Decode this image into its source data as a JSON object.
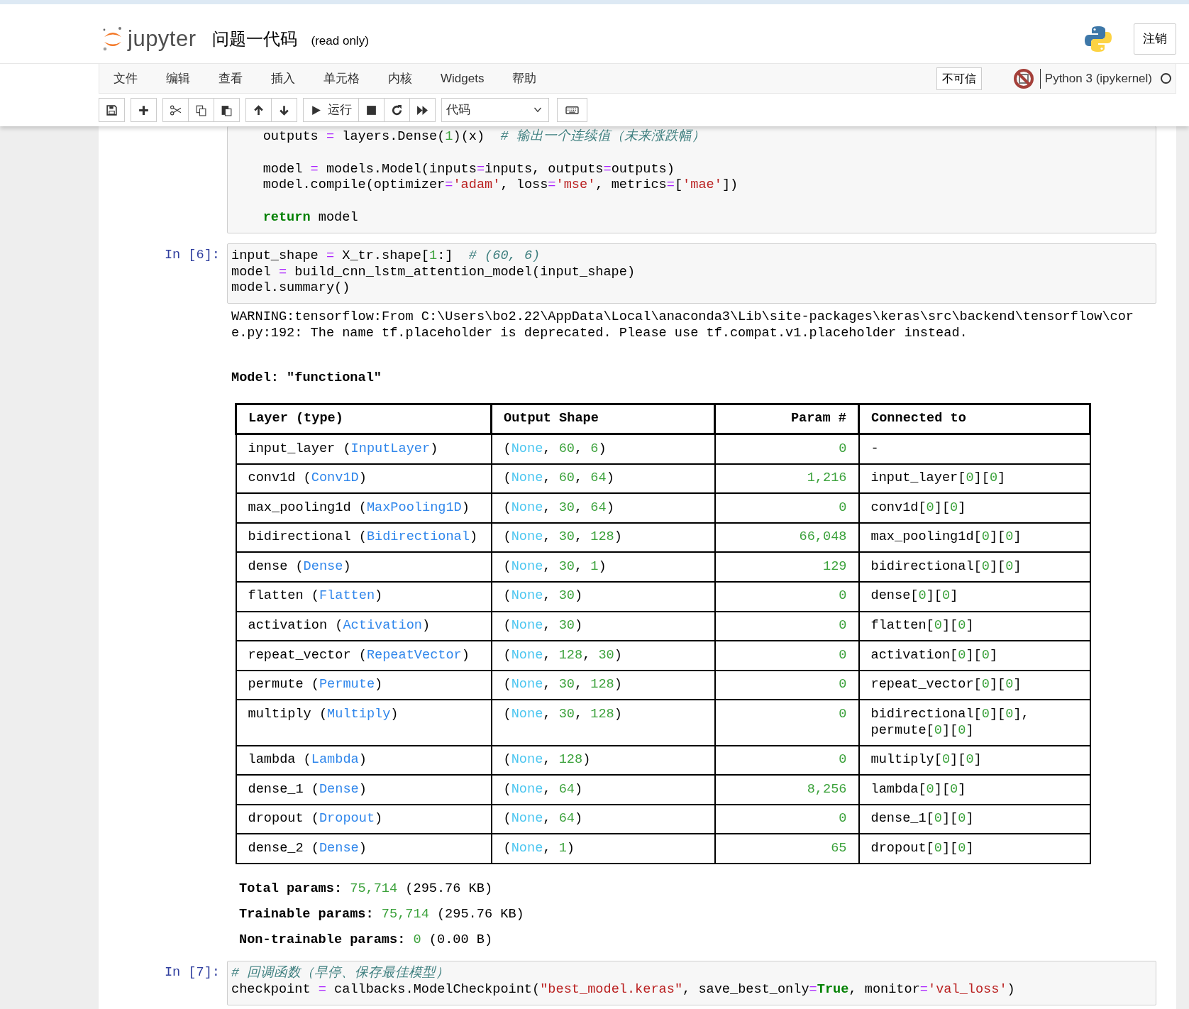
{
  "header": {
    "logo_text": "jupyter",
    "notebook_title": "问题一代码",
    "mode_note": "(read only)",
    "logout_button": "注销"
  },
  "menubar": {
    "menus": [
      "文件",
      "编辑",
      "查看",
      "插入",
      "单元格",
      "内核",
      "Widgets",
      "帮助"
    ],
    "trust_badge": "不可信",
    "kernel_name": "Python 3 (ipykernel)",
    "kernel_idle": true
  },
  "toolbar": {
    "run_label": "运行",
    "cell_type": "代码"
  },
  "cells": [
    {
      "code_blocks": [
        [
          [
            {
              "text": "    outputs ",
              "kind": "plain"
            },
            {
              "text": "=",
              "kind": "op"
            },
            {
              "text": " layers.Dense(",
              "kind": "plain"
            },
            {
              "text": "1",
              "kind": "num"
            },
            {
              "text": ")(x)  ",
              "kind": "plain"
            },
            {
              "text": "# 输出一个连续值（未来涨跌幅）",
              "kind": "cmt"
            }
          ]
        ],
        [
          [
            {
              "text": "    model ",
              "kind": "plain"
            },
            {
              "text": "=",
              "kind": "op"
            },
            {
              "text": " models.Model(inputs",
              "kind": "plain"
            },
            {
              "text": "=",
              "kind": "op"
            },
            {
              "text": "inputs, outputs",
              "kind": "plain"
            },
            {
              "text": "=",
              "kind": "op"
            },
            {
              "text": "outputs)",
              "kind": "plain"
            }
          ],
          [
            {
              "text": "    model.compile(optimizer",
              "kind": "plain"
            },
            {
              "text": "=",
              "kind": "op"
            },
            {
              "text": "'adam'",
              "kind": "str"
            },
            {
              "text": ", loss",
              "kind": "plain"
            },
            {
              "text": "=",
              "kind": "op"
            },
            {
              "text": "'mse'",
              "kind": "str"
            },
            {
              "text": ", metrics",
              "kind": "plain"
            },
            {
              "text": "=",
              "kind": "op"
            },
            {
              "text": "[",
              "kind": "plain"
            },
            {
              "text": "'mae'",
              "kind": "str"
            },
            {
              "text": "])",
              "kind": "plain"
            }
          ]
        ],
        [
          [
            {
              "text": "    return",
              "kind": "kw"
            },
            {
              "text": " model",
              "kind": "plain"
            }
          ]
        ]
      ]
    },
    {
      "prompt": "In [6]:",
      "code_blocks": [
        [
          [
            {
              "text": "input_shape ",
              "kind": "plain"
            },
            {
              "text": "=",
              "kind": "op"
            },
            {
              "text": " X_tr.shape[",
              "kind": "plain"
            },
            {
              "text": "1",
              "kind": "num"
            },
            {
              "text": ":]  ",
              "kind": "plain"
            },
            {
              "text": "# (60, 6)",
              "kind": "cmt"
            }
          ],
          [
            {
              "text": "model ",
              "kind": "plain"
            },
            {
              "text": "=",
              "kind": "op"
            },
            {
              "text": " build_cnn_lstm_attention_model(input_shape)",
              "kind": "plain"
            }
          ],
          [
            {
              "text": "model.summary()",
              "kind": "plain"
            }
          ]
        ]
      ],
      "output": {
        "warning": "WARNING:tensorflow:From C:\\Users\\bo2.22\\AppData\\Local\\anaconda3\\Lib\\site-packages\\keras\\src\\backend\\tensorflow\\core.py:192: The name tf.placeholder is deprecated. Please use tf.compat.v1.placeholder instead.",
        "model_title": "Model: \"functional\"",
        "summary_table": {
          "columns": [
            "Layer (type)",
            "Output Shape",
            "Param #",
            "Connected to"
          ],
          "rows": [
            {
              "layer": [
                {
                  "text": "input_layer (",
                  "kind": "plain"
                },
                {
                  "text": "InputLayer",
                  "kind": "type"
                },
                {
                  "text": ")",
                  "kind": "plain"
                }
              ],
              "output_shape": [
                {
                  "text": "(",
                  "kind": "plain"
                },
                {
                  "text": "None",
                  "kind": "none"
                },
                {
                  "text": ", ",
                  "kind": "plain"
                },
                {
                  "text": "60",
                  "kind": "num"
                },
                {
                  "text": ", ",
                  "kind": "plain"
                },
                {
                  "text": "6",
                  "kind": "num"
                },
                {
                  "text": ")",
                  "kind": "plain"
                }
              ],
              "param_count": "0",
              "connected_to": [
                {
                  "text": "-",
                  "kind": "plain"
                }
              ]
            },
            {
              "layer": [
                {
                  "text": "conv1d (",
                  "kind": "plain"
                },
                {
                  "text": "Conv1D",
                  "kind": "type"
                },
                {
                  "text": ")",
                  "kind": "plain"
                }
              ],
              "output_shape": [
                {
                  "text": "(",
                  "kind": "plain"
                },
                {
                  "text": "None",
                  "kind": "none"
                },
                {
                  "text": ", ",
                  "kind": "plain"
                },
                {
                  "text": "60",
                  "kind": "num"
                },
                {
                  "text": ", ",
                  "kind": "plain"
                },
                {
                  "text": "64",
                  "kind": "num"
                },
                {
                  "text": ")",
                  "kind": "plain"
                }
              ],
              "param_count": "1,216",
              "connected_to": [
                {
                  "text": "input_layer[",
                  "kind": "plain"
                },
                {
                  "text": "0",
                  "kind": "num"
                },
                {
                  "text": "][",
                  "kind": "plain"
                },
                {
                  "text": "0",
                  "kind": "num"
                },
                {
                  "text": "]",
                  "kind": "plain"
                }
              ]
            },
            {
              "layer": [
                {
                  "text": "max_pooling1d (",
                  "kind": "plain"
                },
                {
                  "text": "MaxPooling1D",
                  "kind": "type"
                },
                {
                  "text": ")",
                  "kind": "plain"
                }
              ],
              "output_shape": [
                {
                  "text": "(",
                  "kind": "plain"
                },
                {
                  "text": "None",
                  "kind": "none"
                },
                {
                  "text": ", ",
                  "kind": "plain"
                },
                {
                  "text": "30",
                  "kind": "num"
                },
                {
                  "text": ", ",
                  "kind": "plain"
                },
                {
                  "text": "64",
                  "kind": "num"
                },
                {
                  "text": ")",
                  "kind": "plain"
                }
              ],
              "param_count": "0",
              "connected_to": [
                {
                  "text": "conv1d[",
                  "kind": "plain"
                },
                {
                  "text": "0",
                  "kind": "num"
                },
                {
                  "text": "][",
                  "kind": "plain"
                },
                {
                  "text": "0",
                  "kind": "num"
                },
                {
                  "text": "]",
                  "kind": "plain"
                }
              ]
            },
            {
              "layer": [
                {
                  "text": "bidirectional (",
                  "kind": "plain"
                },
                {
                  "text": "Bidirectional",
                  "kind": "type"
                },
                {
                  "text": ")",
                  "kind": "plain"
                }
              ],
              "output_shape": [
                {
                  "text": "(",
                  "kind": "plain"
                },
                {
                  "text": "None",
                  "kind": "none"
                },
                {
                  "text": ", ",
                  "kind": "plain"
                },
                {
                  "text": "30",
                  "kind": "num"
                },
                {
                  "text": ", ",
                  "kind": "plain"
                },
                {
                  "text": "128",
                  "kind": "num"
                },
                {
                  "text": ")",
                  "kind": "plain"
                }
              ],
              "param_count": "66,048",
              "connected_to": [
                {
                  "text": "max_pooling1d[",
                  "kind": "plain"
                },
                {
                  "text": "0",
                  "kind": "num"
                },
                {
                  "text": "][",
                  "kind": "plain"
                },
                {
                  "text": "0",
                  "kind": "num"
                },
                {
                  "text": "]",
                  "kind": "plain"
                }
              ]
            },
            {
              "layer": [
                {
                  "text": "dense (",
                  "kind": "plain"
                },
                {
                  "text": "Dense",
                  "kind": "type"
                },
                {
                  "text": ")",
                  "kind": "plain"
                }
              ],
              "output_shape": [
                {
                  "text": "(",
                  "kind": "plain"
                },
                {
                  "text": "None",
                  "kind": "none"
                },
                {
                  "text": ", ",
                  "kind": "plain"
                },
                {
                  "text": "30",
                  "kind": "num"
                },
                {
                  "text": ", ",
                  "kind": "plain"
                },
                {
                  "text": "1",
                  "kind": "num"
                },
                {
                  "text": ")",
                  "kind": "plain"
                }
              ],
              "param_count": "129",
              "connected_to": [
                {
                  "text": "bidirectional[",
                  "kind": "plain"
                },
                {
                  "text": "0",
                  "kind": "num"
                },
                {
                  "text": "][",
                  "kind": "plain"
                },
                {
                  "text": "0",
                  "kind": "num"
                },
                {
                  "text": "]",
                  "kind": "plain"
                }
              ]
            },
            {
              "layer": [
                {
                  "text": "flatten (",
                  "kind": "plain"
                },
                {
                  "text": "Flatten",
                  "kind": "type"
                },
                {
                  "text": ")",
                  "kind": "plain"
                }
              ],
              "output_shape": [
                {
                  "text": "(",
                  "kind": "plain"
                },
                {
                  "text": "None",
                  "kind": "none"
                },
                {
                  "text": ", ",
                  "kind": "plain"
                },
                {
                  "text": "30",
                  "kind": "num"
                },
                {
                  "text": ")",
                  "kind": "plain"
                }
              ],
              "param_count": "0",
              "connected_to": [
                {
                  "text": "dense[",
                  "kind": "plain"
                },
                {
                  "text": "0",
                  "kind": "num"
                },
                {
                  "text": "][",
                  "kind": "plain"
                },
                {
                  "text": "0",
                  "kind": "num"
                },
                {
                  "text": "]",
                  "kind": "plain"
                }
              ]
            },
            {
              "layer": [
                {
                  "text": "activation (",
                  "kind": "plain"
                },
                {
                  "text": "Activation",
                  "kind": "type"
                },
                {
                  "text": ")",
                  "kind": "plain"
                }
              ],
              "output_shape": [
                {
                  "text": "(",
                  "kind": "plain"
                },
                {
                  "text": "None",
                  "kind": "none"
                },
                {
                  "text": ", ",
                  "kind": "plain"
                },
                {
                  "text": "30",
                  "kind": "num"
                },
                {
                  "text": ")",
                  "kind": "plain"
                }
              ],
              "param_count": "0",
              "connected_to": [
                {
                  "text": "flatten[",
                  "kind": "plain"
                },
                {
                  "text": "0",
                  "kind": "num"
                },
                {
                  "text": "][",
                  "kind": "plain"
                },
                {
                  "text": "0",
                  "kind": "num"
                },
                {
                  "text": "]",
                  "kind": "plain"
                }
              ]
            },
            {
              "layer": [
                {
                  "text": "repeat_vector (",
                  "kind": "plain"
                },
                {
                  "text": "RepeatVector",
                  "kind": "type"
                },
                {
                  "text": ")",
                  "kind": "plain"
                }
              ],
              "output_shape": [
                {
                  "text": "(",
                  "kind": "plain"
                },
                {
                  "text": "None",
                  "kind": "none"
                },
                {
                  "text": ", ",
                  "kind": "plain"
                },
                {
                  "text": "128",
                  "kind": "num"
                },
                {
                  "text": ", ",
                  "kind": "plain"
                },
                {
                  "text": "30",
                  "kind": "num"
                },
                {
                  "text": ")",
                  "kind": "plain"
                }
              ],
              "param_count": "0",
              "connected_to": [
                {
                  "text": "activation[",
                  "kind": "plain"
                },
                {
                  "text": "0",
                  "kind": "num"
                },
                {
                  "text": "][",
                  "kind": "plain"
                },
                {
                  "text": "0",
                  "kind": "num"
                },
                {
                  "text": "]",
                  "kind": "plain"
                }
              ]
            },
            {
              "layer": [
                {
                  "text": "permute (",
                  "kind": "plain"
                },
                {
                  "text": "Permute",
                  "kind": "type"
                },
                {
                  "text": ")",
                  "kind": "plain"
                }
              ],
              "output_shape": [
                {
                  "text": "(",
                  "kind": "plain"
                },
                {
                  "text": "None",
                  "kind": "none"
                },
                {
                  "text": ", ",
                  "kind": "plain"
                },
                {
                  "text": "30",
                  "kind": "num"
                },
                {
                  "text": ", ",
                  "kind": "plain"
                },
                {
                  "text": "128",
                  "kind": "num"
                },
                {
                  "text": ")",
                  "kind": "plain"
                }
              ],
              "param_count": "0",
              "connected_to": [
                {
                  "text": "repeat_vector[",
                  "kind": "plain"
                },
                {
                  "text": "0",
                  "kind": "num"
                },
                {
                  "text": "][",
                  "kind": "plain"
                },
                {
                  "text": "0",
                  "kind": "num"
                },
                {
                  "text": "]",
                  "kind": "plain"
                }
              ]
            },
            {
              "layer": [
                {
                  "text": "multiply (",
                  "kind": "plain"
                },
                {
                  "text": "Multiply",
                  "kind": "type"
                },
                {
                  "text": ")",
                  "kind": "plain"
                }
              ],
              "output_shape": [
                {
                  "text": "(",
                  "kind": "plain"
                },
                {
                  "text": "None",
                  "kind": "none"
                },
                {
                  "text": ", ",
                  "kind": "plain"
                },
                {
                  "text": "30",
                  "kind": "num"
                },
                {
                  "text": ", ",
                  "kind": "plain"
                },
                {
                  "text": "128",
                  "kind": "num"
                },
                {
                  "text": ")",
                  "kind": "plain"
                }
              ],
              "param_count": "0",
              "connected_to": [
                {
                  "text": "bidirectional[",
                  "kind": "plain"
                },
                {
                  "text": "0",
                  "kind": "num"
                },
                {
                  "text": "][",
                  "kind": "plain"
                },
                {
                  "text": "0",
                  "kind": "num"
                },
                {
                  "text": "],\npermute[",
                  "kind": "plain"
                },
                {
                  "text": "0",
                  "kind": "num"
                },
                {
                  "text": "][",
                  "kind": "plain"
                },
                {
                  "text": "0",
                  "kind": "num"
                },
                {
                  "text": "]",
                  "kind": "plain"
                }
              ]
            },
            {
              "layer": [
                {
                  "text": "lambda (",
                  "kind": "plain"
                },
                {
                  "text": "Lambda",
                  "kind": "type"
                },
                {
                  "text": ")",
                  "kind": "plain"
                }
              ],
              "output_shape": [
                {
                  "text": "(",
                  "kind": "plain"
                },
                {
                  "text": "None",
                  "kind": "none"
                },
                {
                  "text": ", ",
                  "kind": "plain"
                },
                {
                  "text": "128",
                  "kind": "num"
                },
                {
                  "text": ")",
                  "kind": "plain"
                }
              ],
              "param_count": "0",
              "connected_to": [
                {
                  "text": "multiply[",
                  "kind": "plain"
                },
                {
                  "text": "0",
                  "kind": "num"
                },
                {
                  "text": "][",
                  "kind": "plain"
                },
                {
                  "text": "0",
                  "kind": "num"
                },
                {
                  "text": "]",
                  "kind": "plain"
                }
              ]
            },
            {
              "layer": [
                {
                  "text": "dense_1 (",
                  "kind": "plain"
                },
                {
                  "text": "Dense",
                  "kind": "type"
                },
                {
                  "text": ")",
                  "kind": "plain"
                }
              ],
              "output_shape": [
                {
                  "text": "(",
                  "kind": "plain"
                },
                {
                  "text": "None",
                  "kind": "none"
                },
                {
                  "text": ", ",
                  "kind": "plain"
                },
                {
                  "text": "64",
                  "kind": "num"
                },
                {
                  "text": ")",
                  "kind": "plain"
                }
              ],
              "param_count": "8,256",
              "connected_to": [
                {
                  "text": "lambda[",
                  "kind": "plain"
                },
                {
                  "text": "0",
                  "kind": "num"
                },
                {
                  "text": "][",
                  "kind": "plain"
                },
                {
                  "text": "0",
                  "kind": "num"
                },
                {
                  "text": "]",
                  "kind": "plain"
                }
              ]
            },
            {
              "layer": [
                {
                  "text": "dropout (",
                  "kind": "plain"
                },
                {
                  "text": "Dropout",
                  "kind": "type"
                },
                {
                  "text": ")",
                  "kind": "plain"
                }
              ],
              "output_shape": [
                {
                  "text": "(",
                  "kind": "plain"
                },
                {
                  "text": "None",
                  "kind": "none"
                },
                {
                  "text": ", ",
                  "kind": "plain"
                },
                {
                  "text": "64",
                  "kind": "num"
                },
                {
                  "text": ")",
                  "kind": "plain"
                }
              ],
              "param_count": "0",
              "connected_to": [
                {
                  "text": "dense_1[",
                  "kind": "plain"
                },
                {
                  "text": "0",
                  "kind": "num"
                },
                {
                  "text": "][",
                  "kind": "plain"
                },
                {
                  "text": "0",
                  "kind": "num"
                },
                {
                  "text": "]",
                  "kind": "plain"
                }
              ]
            },
            {
              "layer": [
                {
                  "text": "dense_2 (",
                  "kind": "plain"
                },
                {
                  "text": "Dense",
                  "kind": "type"
                },
                {
                  "text": ")",
                  "kind": "plain"
                }
              ],
              "output_shape": [
                {
                  "text": "(",
                  "kind": "plain"
                },
                {
                  "text": "None",
                  "kind": "none"
                },
                {
                  "text": ", ",
                  "kind": "plain"
                },
                {
                  "text": "1",
                  "kind": "num"
                },
                {
                  "text": ")",
                  "kind": "plain"
                }
              ],
              "param_count": "65",
              "connected_to": [
                {
                  "text": "dropout[",
                  "kind": "plain"
                },
                {
                  "text": "0",
                  "kind": "num"
                },
                {
                  "text": "][",
                  "kind": "plain"
                },
                {
                  "text": "0",
                  "kind": "num"
                },
                {
                  "text": "]",
                  "kind": "plain"
                }
              ]
            }
          ]
        },
        "totals": [
          {
            "label": "Total params:",
            "value": "75,714",
            "detail": "(295.76 KB)"
          },
          {
            "label": "Trainable params:",
            "value": "75,714",
            "detail": "(295.76 KB)"
          },
          {
            "label": "Non-trainable params:",
            "value": "0",
            "detail": "(0.00 B)"
          }
        ]
      }
    },
    {
      "prompt": "In [7]:",
      "code_blocks": [
        [
          [
            {
              "text": "# 回调函数（早停、保存最佳模型）",
              "kind": "cmt"
            }
          ],
          [
            {
              "text": "checkpoint ",
              "kind": "plain"
            },
            {
              "text": "=",
              "kind": "op"
            },
            {
              "text": " callbacks.ModelCheckpoint(",
              "kind": "plain"
            },
            {
              "text": "\"best_model.keras\"",
              "kind": "str"
            },
            {
              "text": ", save_best_only",
              "kind": "plain"
            },
            {
              "text": "=",
              "kind": "op"
            },
            {
              "text": "True",
              "kind": "bool"
            },
            {
              "text": ", monitor",
              "kind": "plain"
            },
            {
              "text": "=",
              "kind": "op"
            },
            {
              "text": "'val_loss'",
              "kind": "str"
            },
            {
              "text": ")",
              "kind": "plain"
            }
          ]
        ]
      ]
    }
  ]
}
